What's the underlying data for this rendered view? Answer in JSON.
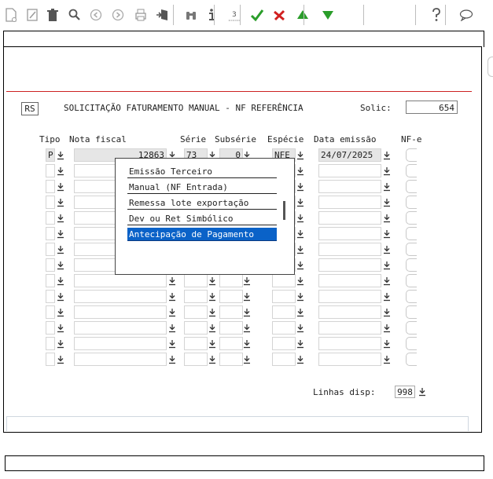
{
  "toolbar": {
    "buttons": [
      {
        "name": "new-doc-icon",
        "color": "#9a9a9a"
      },
      {
        "name": "edit-icon",
        "color": "#9a9a9a"
      },
      {
        "name": "delete-icon",
        "color": "#555555"
      },
      {
        "name": "search-icon",
        "color": "#555555"
      },
      {
        "name": "previous-icon",
        "color": "#aaaaaa"
      },
      {
        "name": "next-icon",
        "color": "#aaaaaa"
      },
      {
        "name": "print-icon",
        "color": "#9a9a9a"
      },
      {
        "name": "exit-icon",
        "color": "#555555"
      },
      {
        "name": "binoculars-icon",
        "color": "#777777"
      },
      {
        "name": "info-icon",
        "color": "#555555"
      },
      {
        "name": "numbering-icon",
        "color": "#555555"
      },
      {
        "name": "confirm-icon",
        "color": "#2a9d2a"
      },
      {
        "name": "cancel-icon",
        "color": "#d02020"
      },
      {
        "name": "move-up-icon",
        "color": "#2a9d2a"
      },
      {
        "name": "move-down-icon",
        "color": "#2a9d2a"
      },
      {
        "name": "help-icon",
        "color": "#555555"
      },
      {
        "name": "chat-icon",
        "color": "#555555"
      }
    ]
  },
  "form": {
    "rs_label": "RS",
    "title": "SOLICITAÇÃO FATURAMENTO MANUAL - NF REFERÊNCIA",
    "solic_label": "Solic:",
    "solic_value": "654"
  },
  "table": {
    "headers": {
      "tipo": "Tipo",
      "nota": "Nota fiscal",
      "serie": "Série",
      "subserie": "Subsérie",
      "especie": "Espécie",
      "data": "Data emissão",
      "nfe": "NF-e"
    },
    "first_row": {
      "tipo": "P",
      "nota": "12863",
      "serie": "73",
      "subserie": "0",
      "especie": "NFE",
      "data": "24/07/2025"
    },
    "row_count": 14
  },
  "dropdown": {
    "options": [
      "Emissão Terceiro",
      "Manual (NF Entrada)",
      "Remessa lote exportação",
      "Dev ou Ret Simbólico",
      "Antecipação de Pagamento"
    ],
    "selected_index": 4
  },
  "footer": {
    "linhas_label": "Linhas disp:",
    "linhas_value": "998"
  },
  "colors": {
    "accent_line": "#cc2222",
    "selection": "#0a62c8"
  }
}
